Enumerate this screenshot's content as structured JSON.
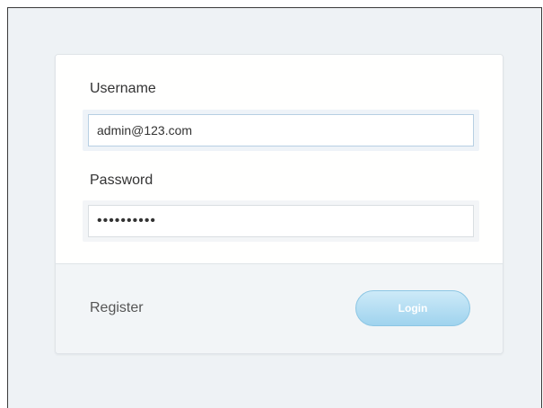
{
  "form": {
    "username_label": "Username",
    "username_value": "admin@123.com",
    "password_label": "Password",
    "password_value": "••••••••••"
  },
  "footer": {
    "register_label": "Register",
    "login_label": "Login"
  },
  "colors": {
    "page_background": "#eef2f5",
    "login_button": "#a8d8f0",
    "input_focus_border": "#b7cfe3"
  }
}
